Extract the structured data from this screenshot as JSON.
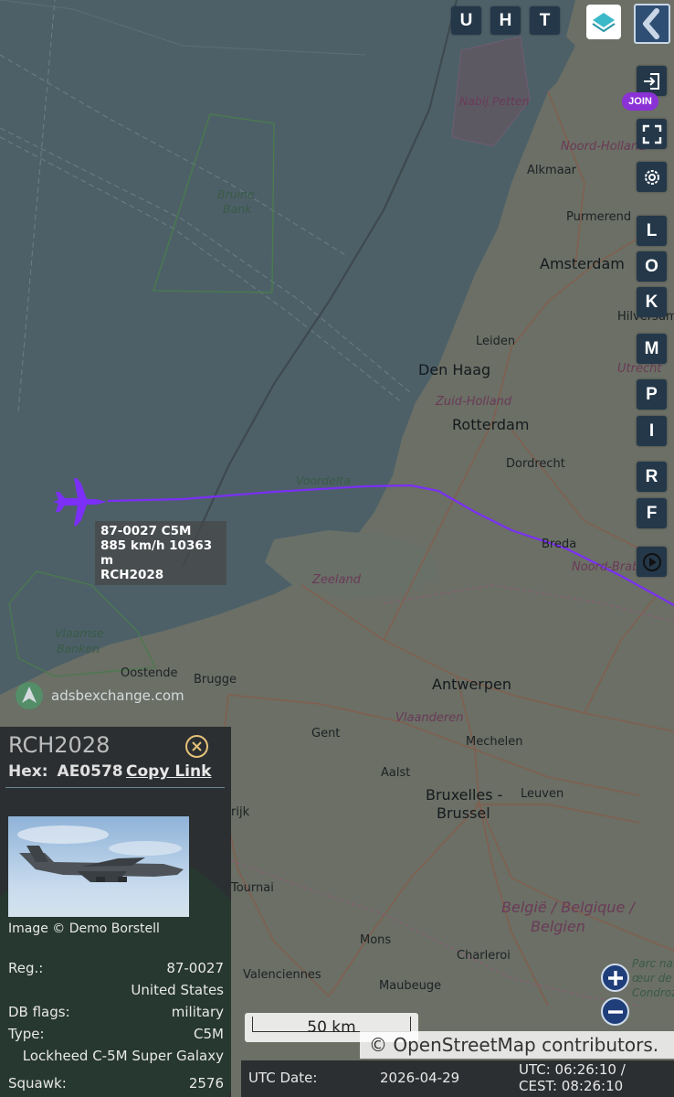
{
  "map": {
    "labels": {
      "nabij_petten": "Nabij Petten",
      "noord_holland": "Noord-Holland",
      "alkmaar": "Alkmaar",
      "purmerend": "Purmerend",
      "amsterdam": "Amsterdam",
      "hilversum": "Hilversum",
      "utrecht": "Utrecht",
      "leiden": "Leiden",
      "den_haag": "Den Haag",
      "zuid_holland": "Zuid-Holland",
      "rotterdam": "Rotterdam",
      "dordrecht": "Dordrecht",
      "voordelta": "Voordelta",
      "breda": "Breda",
      "noord_brabant": "Noord-Brab",
      "zeeland": "Zeeland",
      "bruine_bank": "Bruine",
      "bruine_bank2": "Bank",
      "vlaamse_banken": "Vlaamse",
      "vlaamse_banken2": "Banken",
      "oostende": "Oostende",
      "brugge": "Brugge",
      "antwerpen": "Antwerpen",
      "vlaanderen": "Vlaanderen",
      "gent": "Gent",
      "mechelen": "Mechelen",
      "aalst": "Aalst",
      "bruxelles": "Bruxelles -",
      "brussel": "Brussel",
      "leuven": "Leuven",
      "tournai": "Tournai",
      "mons": "Mons",
      "charleroi": "Charleroi",
      "valenciennes": "Valenciennes",
      "maubeuge": "Maubeuge",
      "belgie1": "België / Belgique /",
      "belgie2": "Belgien",
      "parc_naturel": "Parc naturel",
      "coeur_de": "œur de",
      "condroz": "Condroz",
      "rijk": "rijk"
    }
  },
  "toolbar": {
    "top_buttons": [
      "U",
      "H",
      "T"
    ],
    "side_buttons": [
      "L",
      "O",
      "K",
      "M",
      "P",
      "I",
      "R",
      "F"
    ],
    "join_label": "JOIN"
  },
  "aircraft": {
    "label_line1": "87-0027 C5M",
    "label_line2": "885 km/h  10363 m",
    "label_line3": "RCH2028",
    "color": "#7b2ff7"
  },
  "watermark": "adsbexchange.com",
  "panel": {
    "callsign": "RCH2028",
    "hex_label": "Hex:",
    "hex_value": "AE0578",
    "copy_link": "Copy Link",
    "image_credit": "Image © Demo Borstell",
    "reg_label": "Reg.:",
    "reg_value": "87-0027",
    "country": "United States",
    "dbflags_label": "DB flags:",
    "dbflags_value": "military",
    "type_label": "Type:",
    "type_value": "C5M",
    "type_desc": "Lockheed C-5M Super Galaxy",
    "squawk_label": "Squawk:",
    "squawk_value": "2576"
  },
  "scale_text": "50 km",
  "attribution": "© OpenStreetMap contributors.",
  "footer": {
    "utc_date_label": "UTC Date:",
    "utc_date_value": "2026-04-29",
    "utc_time": "UTC: 06:26:10 /",
    "cest_time": "CEST: 08:26:10"
  }
}
